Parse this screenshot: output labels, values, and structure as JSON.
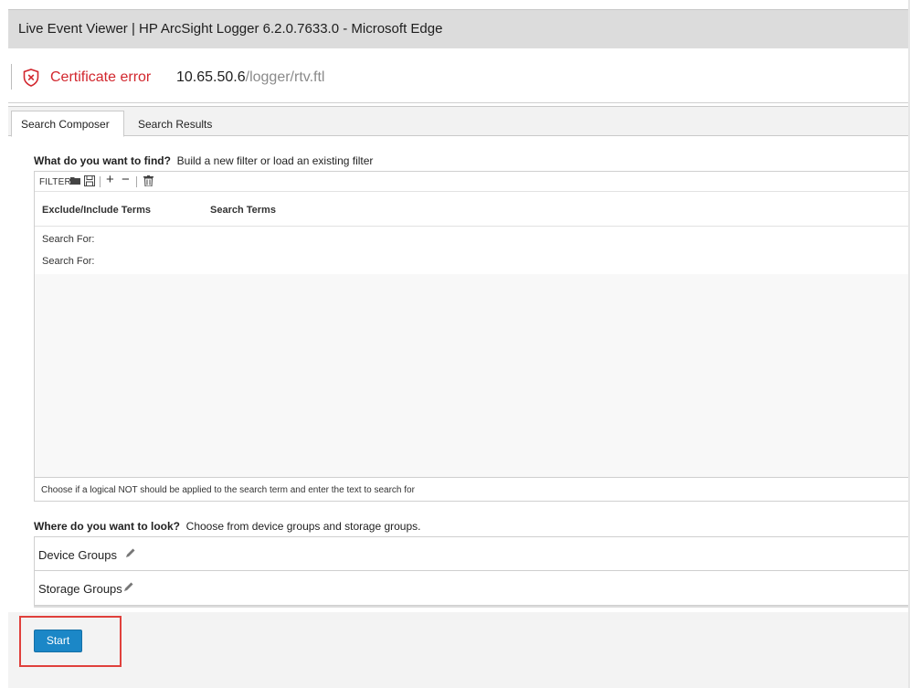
{
  "window": {
    "title": "Live Event Viewer | HP ArcSight Logger 6.2.0.7633.0 - Microsoft Edge"
  },
  "address_bar": {
    "security_status": "Certificate error",
    "url_host": "10.65.50.6",
    "url_path": "/logger/rtv.ftl",
    "status_color": "#d2272e"
  },
  "tabs": [
    {
      "label": "Search Composer",
      "active": true
    },
    {
      "label": "Search Results",
      "active": false
    }
  ],
  "find_section": {
    "heading": "What do you want to find?",
    "subtext": "Build a new filter or load an existing filter",
    "toolbar_label": "FILTER",
    "toolbar_icons": [
      "folder-icon",
      "save-icon",
      "plus-icon",
      "minus-icon",
      "trash-icon"
    ],
    "columns": [
      "Exclude/Include Terms",
      "Search Terms"
    ],
    "rows": [
      "Search For:",
      "Search For:"
    ],
    "hint": "Choose if a logical NOT should be applied to the search term and enter the text to search for"
  },
  "look_section": {
    "heading": "Where do you want to look?",
    "subtext": "Choose from device groups and storage groups.",
    "groups": [
      {
        "label": "Device Groups",
        "icon": "pencil-icon"
      },
      {
        "label": "Storage Groups",
        "icon": "pencil-icon"
      }
    ]
  },
  "actions": {
    "start_label": "Start",
    "accent": "#1b87c7",
    "highlight_color": "#e0403c"
  }
}
